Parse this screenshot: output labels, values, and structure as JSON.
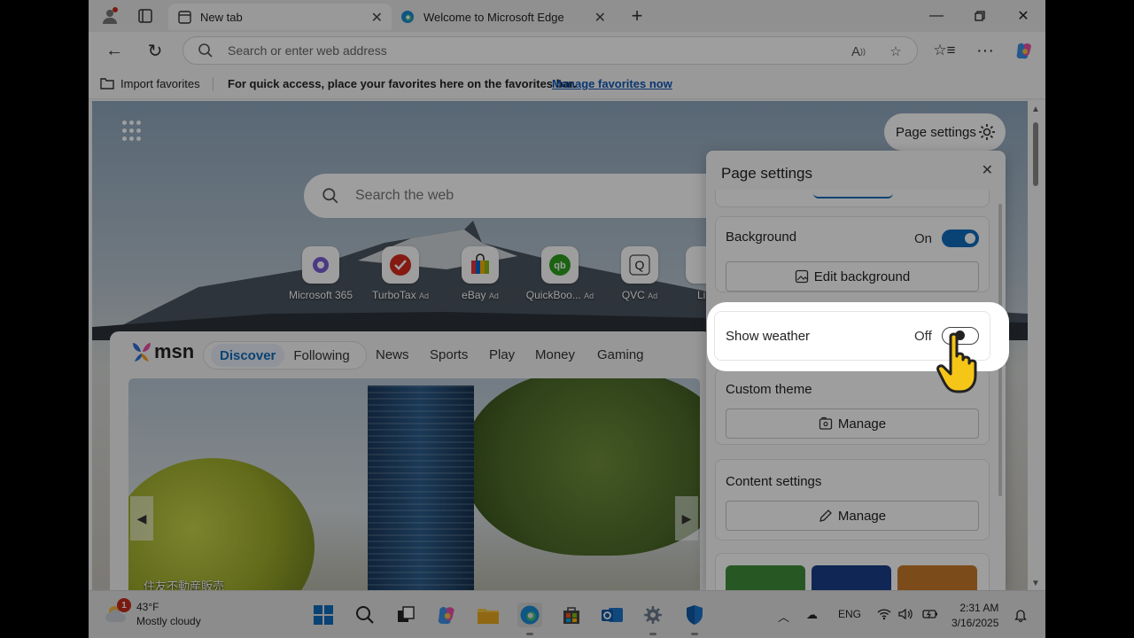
{
  "browser": {
    "tabs": [
      {
        "label": "New tab",
        "active": true
      },
      {
        "label": "Welcome to Microsoft Edge",
        "active": false
      }
    ],
    "address_placeholder": "Search or enter web address"
  },
  "favorites_bar": {
    "import_label": "Import favorites",
    "message": "For quick access, place your favorites here on the favorites bar.",
    "manage_link": "Manage favorites now"
  },
  "newtab": {
    "page_settings_button": "Page settings",
    "search_placeholder": "Search the web",
    "quick_links": [
      {
        "label": "Microsoft 365",
        "ad": ""
      },
      {
        "label": "TurboTax",
        "ad": "Ad"
      },
      {
        "label": "eBay",
        "ad": "Ad"
      },
      {
        "label": "QuickBoo...",
        "ad": "Ad"
      },
      {
        "label": "QVC",
        "ad": "Ad"
      },
      {
        "label": "Li",
        "ad": ""
      }
    ]
  },
  "feed": {
    "logo": "msn",
    "pills": [
      "Discover",
      "Following"
    ],
    "nav": [
      "News",
      "Sports",
      "Play",
      "Money",
      "Gaming"
    ],
    "hero_caption": "住友不動産販売"
  },
  "settings_panel": {
    "title": "Page settings",
    "background": {
      "label": "Background",
      "state": "On",
      "button": "Edit background"
    },
    "show_weather": {
      "label": "Show weather",
      "state": "Off"
    },
    "custom_theme": {
      "label": "Custom theme",
      "button": "Manage"
    },
    "content_settings": {
      "label": "Content settings",
      "button": "Manage"
    }
  },
  "taskbar": {
    "weather_temp": "43°F",
    "weather_desc": "Mostly cloudy",
    "weather_badge": "1",
    "language": "ENG",
    "time": "2:31 AM",
    "date": "3/16/2025"
  },
  "colors": {
    "accent": "#0f6cbd",
    "link": "#0f58b8"
  }
}
